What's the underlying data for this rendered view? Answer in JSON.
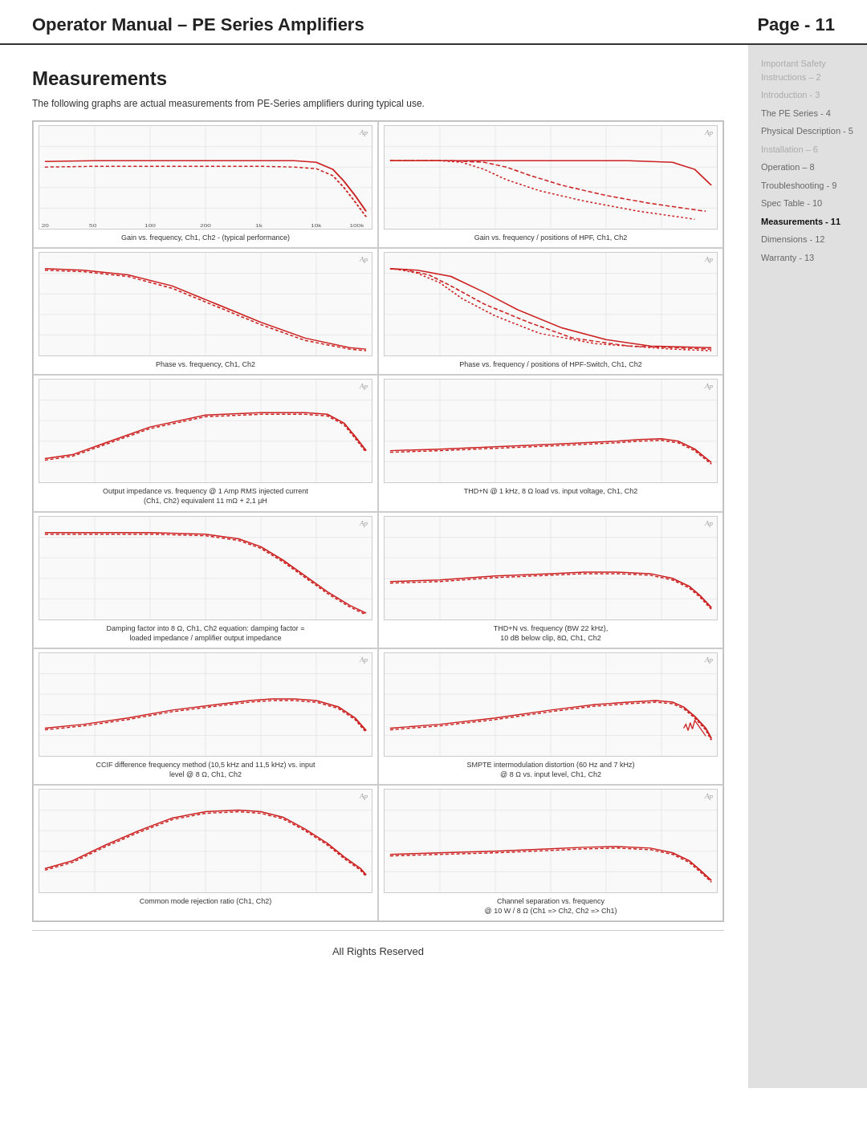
{
  "header": {
    "title": "Operator Manual – PE Series Amplifiers",
    "page": "Page - 11"
  },
  "sidebar": {
    "items": [
      {
        "label": "Important Safety Instructions – 2",
        "state": "light"
      },
      {
        "label": "Introduction - 3",
        "state": "light"
      },
      {
        "label": "The PE Series - 4",
        "state": "normal"
      },
      {
        "label": "Physical Description - 5",
        "state": "normal"
      },
      {
        "label": "Installation – 6",
        "state": "light"
      },
      {
        "label": "Operation – 8",
        "state": "normal"
      },
      {
        "label": "Troubleshooting - 9",
        "state": "normal"
      },
      {
        "label": "Spec Table - 10",
        "state": "normal"
      },
      {
        "label": "Measurements - 11",
        "state": "active"
      },
      {
        "label": "Dimensions - 12",
        "state": "normal"
      },
      {
        "label": "Warranty - 13",
        "state": "normal"
      }
    ]
  },
  "page": {
    "title": "Measurements",
    "intro": "The following graphs are actual measurements from PE-Series amplifiers during typical use."
  },
  "graphs": [
    {
      "caption": "Gain vs. frequency, Ch1, Ch2 - (typical performance)"
    },
    {
      "caption": "Gain vs. frequency / positions of HPF, Ch1, Ch2"
    },
    {
      "caption": "Phase vs. frequency, Ch1, Ch2"
    },
    {
      "caption": "Phase vs. frequency / positions of HPF-Switch, Ch1, Ch2"
    },
    {
      "caption": "Output impedance vs. frequency @ 1 Amp RMS injected current\n(Ch1, Ch2) equivalent 11 mΩ + 2,1 µH"
    },
    {
      "caption": "THD+N @ 1 kHz, 8 Ω load vs. input voltage, Ch1, Ch2"
    },
    {
      "caption": "Damping factor into 8 Ω, Ch1, Ch2 equation: damping factor =\nloaded impedance / amplifier output impedance"
    },
    {
      "caption": "THD+N vs. frequency (BW 22 kHz),\n10 dB below clip, 8Ω, Ch1, Ch2"
    },
    {
      "caption": "CCIF difference frequency method (10,5 kHz and 11,5 kHz) vs. input\nlevel @ 8 Ω, Ch1, Ch2"
    },
    {
      "caption": "SMPTE intermodulation distortion (60 Hz and 7 kHz)\n@ 8 Ω vs. input level, Ch1, Ch2"
    },
    {
      "caption": "Common mode rejection ratio (Ch1, Ch2)"
    },
    {
      "caption": "Channel separation vs. frequency\n@ 10 W / 8 Ω (Ch1 => Ch2, Ch2 => Ch1)"
    }
  ],
  "footer": {
    "text": "All Rights Reserved"
  }
}
